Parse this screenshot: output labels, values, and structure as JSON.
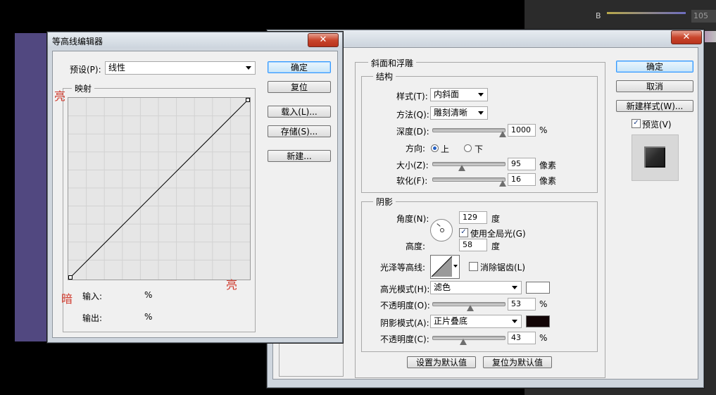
{
  "background": {
    "channel_label": "B",
    "channel_value": "105"
  },
  "contour_editor": {
    "title": "等高线编辑器",
    "close_glyph": "✕",
    "preset_label": "预设(P):",
    "preset_value": "线性",
    "mapping_label": "映射",
    "bright_top": "亮",
    "bright_right": "亮",
    "dark": "暗",
    "input_label": "输入:",
    "input_unit": "%",
    "output_label": "输出:",
    "output_unit": "%",
    "buttons": {
      "ok": "确定",
      "reset": "复位",
      "load": "载入(L)...",
      "save": "存储(S)...",
      "new": "新建..."
    }
  },
  "layer_style": {
    "close_glyph": "✕",
    "section_title": "斜面和浮雕",
    "structure": {
      "title": "结构",
      "style_label": "样式(T):",
      "style_value": "内斜面",
      "technique_label": "方法(Q):",
      "technique_value": "雕刻清晰",
      "depth_label": "深度(D):",
      "depth_value": "1000",
      "depth_unit": "%",
      "depth_level_pct": 100,
      "direction_label": "方向:",
      "direction_up": "上",
      "direction_down": "下",
      "size_label": "大小(Z):",
      "size_value": "95",
      "size_unit": "像素",
      "soften_label": "软化(F):",
      "soften_value": "16",
      "soften_unit": "像素"
    },
    "shading": {
      "title": "阴影",
      "angle_label": "角度(N):",
      "angle_value": "129",
      "angle_unit": "度",
      "global_light_label": "使用全局光(G)",
      "altitude_label": "高度:",
      "altitude_value": "58",
      "altitude_unit": "度",
      "gloss_contour_label": "光泽等高线:",
      "anti_alias_label": "消除锯齿(L)",
      "highlight_mode_label": "高光模式(H):",
      "highlight_mode_value": "滤色",
      "highlight_color": "#ffffff",
      "highlight_opacity_label": "不透明度(O):",
      "highlight_opacity_value": "53",
      "highlight_opacity_unit": "%",
      "shadow_mode_label": "阴影模式(A):",
      "shadow_mode_value": "正片叠底",
      "shadow_color": "#120506",
      "shadow_opacity_label": "不透明度(C):",
      "shadow_opacity_value": "43",
      "shadow_opacity_unit": "%"
    },
    "make_default": "设置为默认值",
    "reset_default": "复位为默认值",
    "buttons": {
      "ok": "确定",
      "cancel": "取消",
      "new_style": "新建样式(W)...",
      "preview": "预览(V)"
    }
  }
}
